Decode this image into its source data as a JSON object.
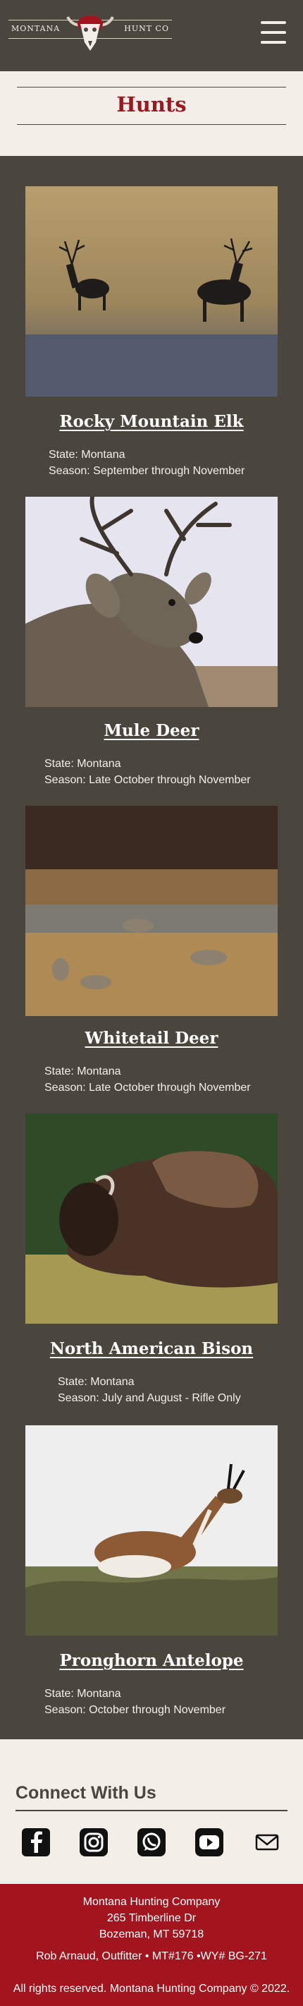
{
  "header": {
    "logo_left": "Montana",
    "logo_right": "Hunt Co"
  },
  "page_title": "Hunts",
  "hunts": [
    {
      "name": "Rocky Mountain Elk",
      "state": "State: Montana",
      "season": "Season: September through November",
      "photo_icon": "elk-photo"
    },
    {
      "name": "Mule Deer",
      "state": "State: Montana",
      "season": "Season: Late October through November",
      "photo_icon": "mule-deer-photo"
    },
    {
      "name": "Whitetail Deer",
      "state": "State: Montana",
      "season": "Season: Late October through November",
      "photo_icon": "whitetail-photo"
    },
    {
      "name": "North American Bison",
      "state": "State: Montana",
      "season": "Season: July and August - Rifle Only",
      "photo_icon": "bison-photo"
    },
    {
      "name": "Pronghorn Antelope",
      "state": "State: Montana",
      "season": "Season: October through November",
      "photo_icon": "antelope-photo"
    }
  ],
  "connect": {
    "heading": "Connect With Us",
    "icons": [
      "facebook-icon",
      "instagram-icon",
      "whatsapp-icon",
      "youtube-icon",
      "mail-icon"
    ]
  },
  "footer": {
    "company": "Montana Hunting Company",
    "street": "265 Timberline Dr",
    "city": "Bozeman, MT 59718",
    "license": "Rob Arnaud, Outfitter • MT#176 •WY# BG-271",
    "copyright": "All rights reserved. Montana Hunting Company © 2022."
  },
  "colors": {
    "dark": "#4b463d",
    "cream": "#f3efe8",
    "accent_red": "#9a1820",
    "footer_red": "#a3151e"
  }
}
